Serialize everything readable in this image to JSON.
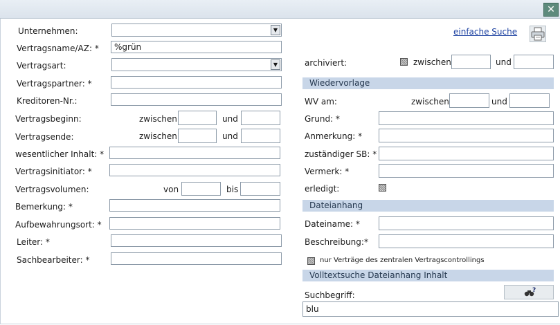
{
  "window": {
    "close_glyph": "✕"
  },
  "top": {
    "simple_search_link": "einfache Suche",
    "print_icon": "printer-icon"
  },
  "left": {
    "unternehmen": "Unternehmen:",
    "vertragsname": "Vertragsname/AZ: *",
    "vertragsname_value": "%grün",
    "vertragsart": "Vertragsart:",
    "vertragspartner": "Vertragspartner: *",
    "kreditoren": "Kreditoren-Nr.:",
    "vertragsbeginn": "Vertragsbeginn:",
    "vertragsende": "Vertragsende:",
    "zwischen": "zwischen",
    "und": "und",
    "inhalt": "wesentlicher Inhalt: *",
    "initiator": "Vertragsinitiator: *",
    "volumen": "Vertragsvolumen:",
    "von": "von",
    "bis": "bis",
    "bemerkung": "Bemerkung: *",
    "aufbewahrung": "Aufbewahrungsort: *",
    "leiter": "Leiter: *",
    "sachbearbeiter": "Sachbearbeiter: *"
  },
  "right": {
    "archiviert": "archiviert:",
    "zwischen": "zwischen",
    "und": "und",
    "wiedervorlage_header": "Wiedervorlage",
    "wv_am": "WV am:",
    "grund": "Grund: *",
    "anmerkung": "Anmerkung: *",
    "sb": "zuständiger SB: *",
    "vermerk": "Vermerk: *",
    "erledigt": "erledigt:",
    "dateianhang_header": "Dateianhang",
    "dateiname": "Dateiname: *",
    "beschreibung": "Beschreibung:*",
    "nur_zentral": "nur Verträge des zentralen Vertragscontrollings",
    "volltext_header": "Volltextsuche Dateianhang Inhalt",
    "suchbegriff": "Suchbegriff:",
    "suchbegriff_value": "blu",
    "help_icon": "binoculars-help-icon"
  }
}
